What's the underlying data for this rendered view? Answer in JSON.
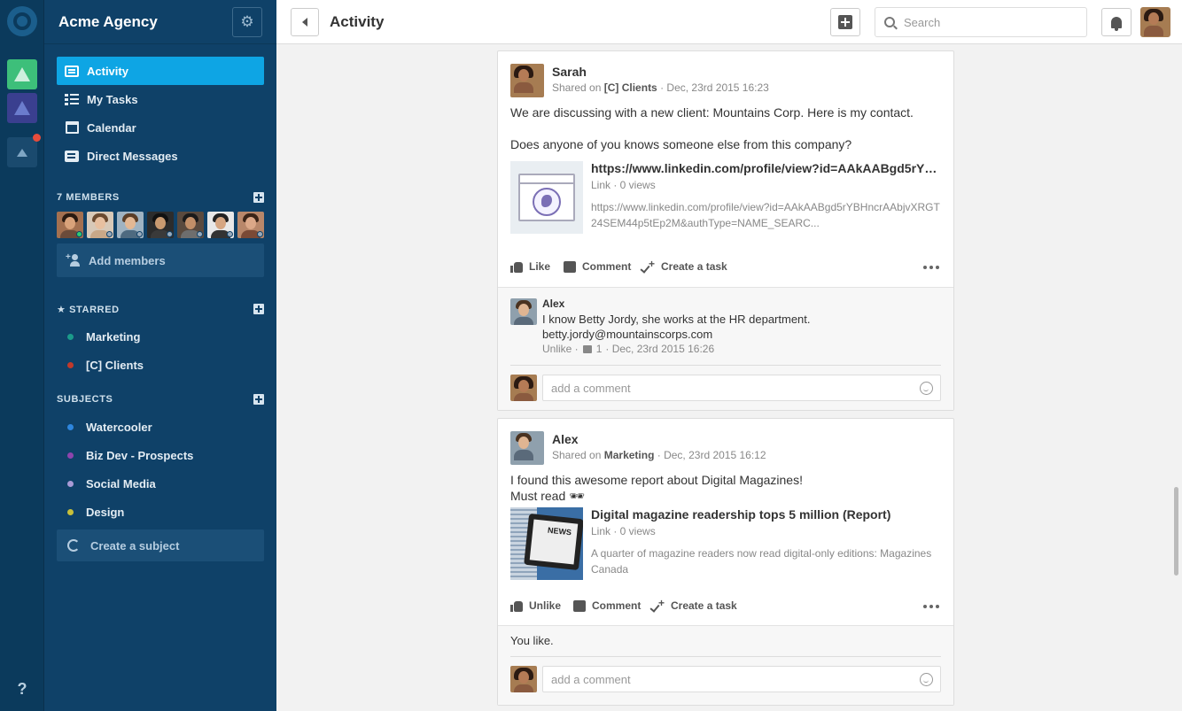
{
  "team": {
    "name": "Acme Agency"
  },
  "nav": [
    {
      "label": "Activity",
      "icon": "activity-icon",
      "active": true
    },
    {
      "label": "My Tasks",
      "icon": "tasks-icon"
    },
    {
      "label": "Calendar",
      "icon": "calendar-icon"
    },
    {
      "label": "Direct Messages",
      "icon": "messages-icon"
    }
  ],
  "members": {
    "title": "7 MEMBERS",
    "add_label": "Add members"
  },
  "starred": {
    "title": "★ STARRED",
    "items": [
      {
        "label": "Marketing",
        "color": "#1b9a8a"
      },
      {
        "label": "[C] Clients",
        "color": "#c0392b"
      }
    ]
  },
  "subjects": {
    "title": "SUBJECTS",
    "items": [
      {
        "label": "Watercooler",
        "color": "#2e86de"
      },
      {
        "label": "Biz Dev - Prospects",
        "color": "#8e44ad"
      },
      {
        "label": "Social Media",
        "color": "#a99bd6"
      },
      {
        "label": "Design",
        "color": "#c8c03a"
      }
    ],
    "create_label": "Create a subject"
  },
  "rail": {
    "help": "?"
  },
  "header": {
    "title": "Activity",
    "search_placeholder": "Search"
  },
  "posts": [
    {
      "author": "Sarah",
      "meta_prefix": "Shared on",
      "channel": "[C] Clients",
      "date": "· Dec, 23rd 2015 16:23",
      "text1": "We are discussing with a new client: Mountains Corp. Here is my contact.",
      "text2": "Does anyone of you knows someone else from this company?",
      "link": {
        "title": "https://www.linkedin.com/profile/view?id=AAkAABgd5rYBHn...",
        "sub": "Link · 0 views",
        "desc": "https://www.linkedin.com/profile/view?id=AAkAABgd5rYBHncrAAbjvXRGT24SEM44p5tEp2M&authType=NAME_SEARC..."
      },
      "actions": {
        "like": "Like",
        "comment": "Comment",
        "task": "Create a task"
      },
      "comment": {
        "author": "Alex",
        "line1": "I know Betty Jordy, she works at the HR department.",
        "line2": "betty.jordy@mountainscorps.com",
        "unlike": "Unlike ·",
        "count": "1",
        "date": "· Dec, 23rd 2015 16:26"
      },
      "comment_placeholder": "add a comment"
    },
    {
      "author": "Alex",
      "meta_prefix": "Shared on",
      "channel": "Marketing",
      "date": "· Dec, 23rd 2015 16:12",
      "text1": "I found this awesome report about Digital Magazines!",
      "text2": "Must read 🕶",
      "link": {
        "title": "Digital magazine readership tops 5 million (Report)",
        "sub": "Link · 0 views",
        "desc": "A quarter of magazine readers now read digital-only editions: Magazines Canada",
        "thumb_text": "NEWS"
      },
      "actions": {
        "like": "Unlike",
        "comment": "Comment",
        "task": "Create a task"
      },
      "likes_text": "You like.",
      "comment_placeholder": "add a comment"
    }
  ]
}
